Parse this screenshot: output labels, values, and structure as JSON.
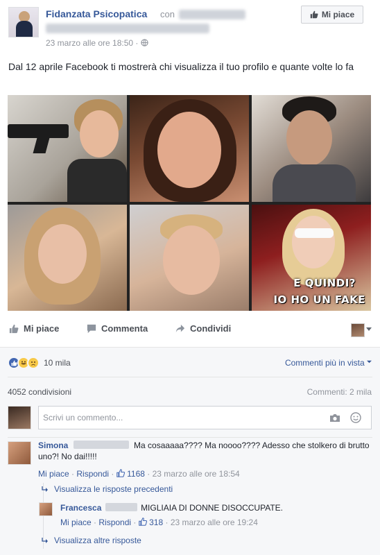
{
  "header": {
    "page_name": "Fidanzata Psicopatica",
    "connector": "con",
    "timestamp": "23 marzo alle ore 18:50 · ",
    "like_button": "Mi piace"
  },
  "post": {
    "text": "Dal 12 aprile Facebook ti mostrerà chi visualizza il tuo profilo e quante volte lo fa",
    "meme_line1": "E QUINDI?",
    "meme_line2": "IO HO UN FAKE"
  },
  "actions": {
    "like": "Mi piace",
    "comment": "Commenta",
    "share": "Condividi"
  },
  "stats": {
    "reactions_count": "10 mila",
    "sort_label": "Commenti più in vista",
    "shares": "4052 condivisioni",
    "comments": "Commenti: 2 mila"
  },
  "composer": {
    "placeholder": "Scrivi un commento..."
  },
  "comments": [
    {
      "name": "Simona",
      "text": "Ma cosaaaaa???? Ma noooo???? Adesso che stolkero di brutto uno?! No dai!!!!!",
      "like": "Mi piace",
      "reply": "Rispondi",
      "likes": "1168",
      "time": "23 marzo alle ore 18:54",
      "previous_replies": "Visualizza le risposte precedenti",
      "replies": [
        {
          "name": "Francesca",
          "text": "MIGLIAIA DI DONNE DISOCCUPATE.",
          "like": "Mi piace",
          "reply": "Rispondi",
          "likes": "318",
          "time": "23 marzo alle ore 19:24"
        }
      ],
      "more_replies": "Visualizza altre risposte"
    }
  ],
  "colors": {
    "link": "#365899",
    "muted": "#90949c",
    "like_blue": "#4267b2",
    "background_grey": "#f6f7f9"
  },
  "icons": [
    "thumbs-up-icon",
    "comment-icon",
    "share-arrow-icon",
    "globe-icon",
    "camera-icon",
    "smiley-icon",
    "reply-arrow-icon",
    "caret-down-icon"
  ]
}
